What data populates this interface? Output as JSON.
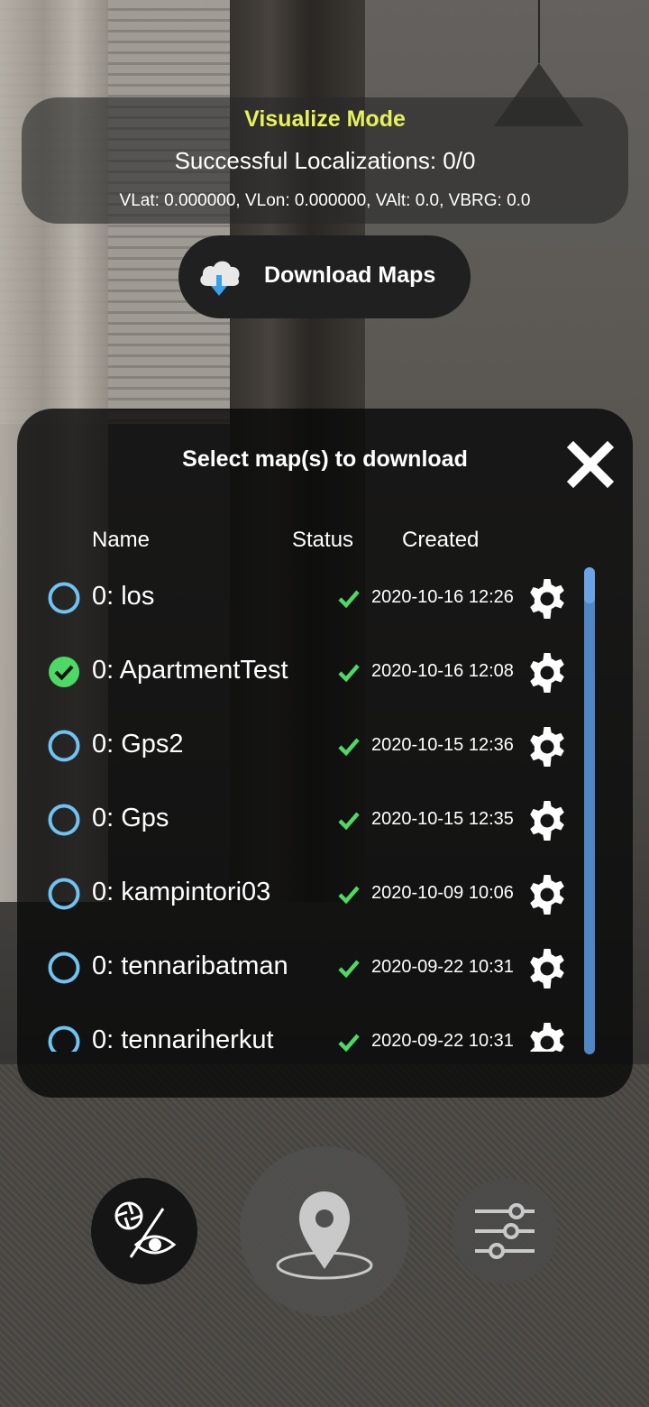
{
  "info": {
    "mode": "Visualize Mode",
    "localizations": "Successful Localizations: 0/0",
    "coords": "VLat: 0.000000, VLon: 0.000000, VAlt: 0.0, VBRG: 0.0"
  },
  "download_button": {
    "label": "Download Maps",
    "icon": "cloud-download-icon"
  },
  "map_panel": {
    "title": "Select map(s) to download",
    "columns": {
      "name": "Name",
      "status": "Status",
      "created": "Created"
    },
    "maps": [
      {
        "name": "0: los",
        "created": "2020-10-16 12:26",
        "selected": false
      },
      {
        "name": "0: ApartmentTest",
        "created": "2020-10-16 12:08",
        "selected": true
      },
      {
        "name": "0: Gps2",
        "created": "2020-10-15 12:36",
        "selected": false
      },
      {
        "name": "0: Gps",
        "created": "2020-10-15 12:35",
        "selected": false
      },
      {
        "name": "0: kampintori03",
        "created": "2020-10-09 10:06",
        "selected": false
      },
      {
        "name": "0: tennaribatman",
        "created": "2020-09-22 10:31",
        "selected": false
      },
      {
        "name": "0: tennariherkut",
        "created": "2020-09-22 10:31",
        "selected": false
      }
    ]
  },
  "colors": {
    "mode_text": "#e6f25a",
    "radio_unselected": "#6ec3f2",
    "radio_selected": "#4cd964",
    "status_ok": "#4cd964",
    "scrollbar": "#4f86c6"
  },
  "bottom_controls": [
    "camera-eye-toggle-icon",
    "map-pin-icon",
    "sliders-icon"
  ]
}
